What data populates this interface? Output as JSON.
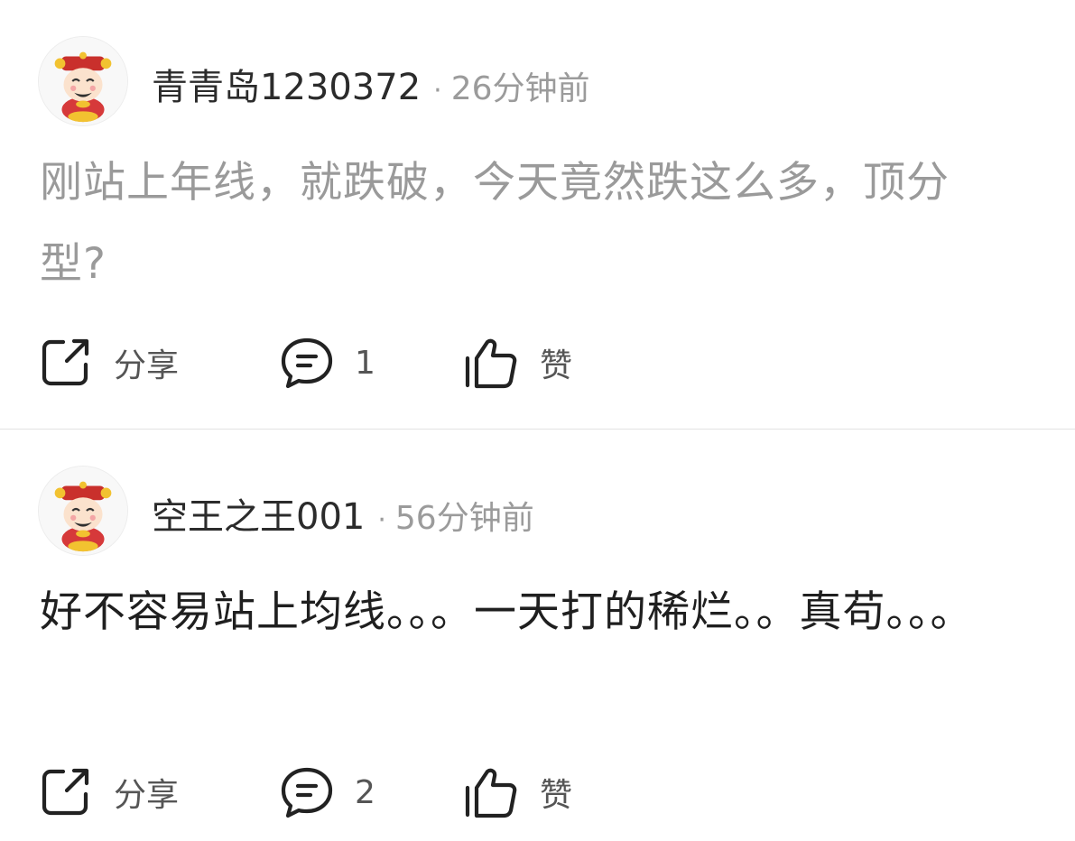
{
  "posts": [
    {
      "username": "青青岛1230372",
      "separator": "·",
      "time": "26分钟前",
      "content": "刚站上年线，就跌破，今天竟然跌这么多，顶分型?",
      "content_color": "#9a9a9a",
      "share_label": "分享",
      "comment_count": "1",
      "like_label": "赞"
    },
    {
      "username": "空王之王001",
      "separator": "·",
      "time": "56分钟前",
      "content": "好不容易站上均线。。。一天打的稀烂。。真苟。。。",
      "content_color": "#1f1f1f",
      "share_label": "分享",
      "comment_count": "2",
      "like_label": "赞"
    }
  ],
  "icons": {
    "avatar": "caishen-avatar-icon",
    "share": "share-icon",
    "comment": "comment-icon",
    "like": "thumbs-up-icon"
  }
}
